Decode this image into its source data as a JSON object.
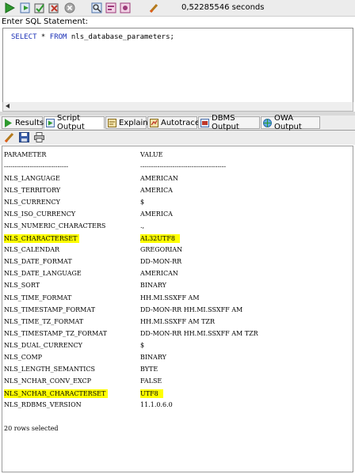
{
  "toolbar": {
    "elapsed": "0,52285546 seconds"
  },
  "editor": {
    "label": "Enter SQL Statement:",
    "sql_keyword1": "SELECT",
    "sql_star": " * ",
    "sql_keyword2": "FROM",
    "sql_rest": " nls_database_parameters;"
  },
  "tabs": [
    {
      "label": "Results",
      "icon": "play-icon"
    },
    {
      "label": "Script Output",
      "icon": "script-icon"
    },
    {
      "label": "Explain",
      "icon": "explain-icon"
    },
    {
      "label": "Autotrace",
      "icon": "autotrace-icon"
    },
    {
      "label": "DBMS Output",
      "icon": "dbms-icon"
    },
    {
      "label": "OWA Output",
      "icon": "globe-icon"
    }
  ],
  "output": {
    "header": {
      "name": "PARAMETER",
      "value": "VALUE"
    },
    "separator": {
      "name": "------------------------------",
      "value": "----------------------------------------"
    },
    "rows": [
      {
        "name": "NLS_LANGUAGE",
        "value": "AMERICAN",
        "highlight": false
      },
      {
        "name": "NLS_TERRITORY",
        "value": "AMERICA",
        "highlight": false
      },
      {
        "name": "NLS_CURRENCY",
        "value": "$",
        "highlight": false
      },
      {
        "name": "NLS_ISO_CURRENCY",
        "value": "AMERICA",
        "highlight": false
      },
      {
        "name": "NLS_NUMERIC_CHARACTERS",
        "value": ".,",
        "highlight": false
      },
      {
        "name": "NLS_CHARACTERSET",
        "value": "AL32UTF8",
        "highlight": true
      },
      {
        "name": "NLS_CALENDAR",
        "value": "GREGORIAN",
        "highlight": false
      },
      {
        "name": "NLS_DATE_FORMAT",
        "value": "DD-MON-RR",
        "highlight": false
      },
      {
        "name": "NLS_DATE_LANGUAGE",
        "value": "AMERICAN",
        "highlight": false
      },
      {
        "name": "NLS_SORT",
        "value": "BINARY",
        "highlight": false
      },
      {
        "name": "NLS_TIME_FORMAT",
        "value": "HH.MI.SSXFF AM",
        "highlight": false
      },
      {
        "name": "NLS_TIMESTAMP_FORMAT",
        "value": "DD-MON-RR HH.MI.SSXFF AM",
        "highlight": false
      },
      {
        "name": "NLS_TIME_TZ_FORMAT",
        "value": "HH.MI.SSXFF AM TZR",
        "highlight": false
      },
      {
        "name": "NLS_TIMESTAMP_TZ_FORMAT",
        "value": "DD-MON-RR HH.MI.SSXFF AM TZR",
        "highlight": false
      },
      {
        "name": "NLS_DUAL_CURRENCY",
        "value": "$",
        "highlight": false
      },
      {
        "name": "NLS_COMP",
        "value": "BINARY",
        "highlight": false
      },
      {
        "name": "NLS_LENGTH_SEMANTICS",
        "value": "BYTE",
        "highlight": false
      },
      {
        "name": "NLS_NCHAR_CONV_EXCP",
        "value": "FALSE",
        "highlight": false
      },
      {
        "name": "NLS_NCHAR_CHARACTERSET",
        "value": "UTF8",
        "highlight": true
      },
      {
        "name": "NLS_RDBMS_VERSION",
        "value": "11.1.0.6.0",
        "highlight": false
      }
    ],
    "footer": "20 rows selected"
  },
  "colors": {
    "highlight": "#ffff00",
    "keyword": "#1a2fb5"
  }
}
